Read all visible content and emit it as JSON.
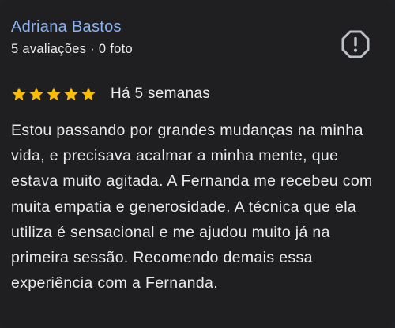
{
  "reviewer": {
    "name": "Adriana Bastos",
    "meta": "5 avaliações · 0 foto"
  },
  "actions": {
    "report_icon": "report-flag-icon"
  },
  "rating": {
    "stars": 5,
    "star_icon": "star-icon",
    "star_color": "#fbbc04",
    "date": "Há 5 semanas"
  },
  "review": {
    "text": "Estou passando por grandes mudanças na minha vida, e precisava acalmar a minha mente, que estava muito agitada. A Fernanda me recebeu com muita empatia e generosidade. A técnica que ela utiliza é sensacional e me ajudou muito já na primeira sessão. Recomendo demais essa experiência com a Fernanda."
  },
  "colors": {
    "background": "#1f1f21",
    "name": "#8ab4f8",
    "text": "#e8eaed",
    "icon": "#bdc1c6"
  }
}
